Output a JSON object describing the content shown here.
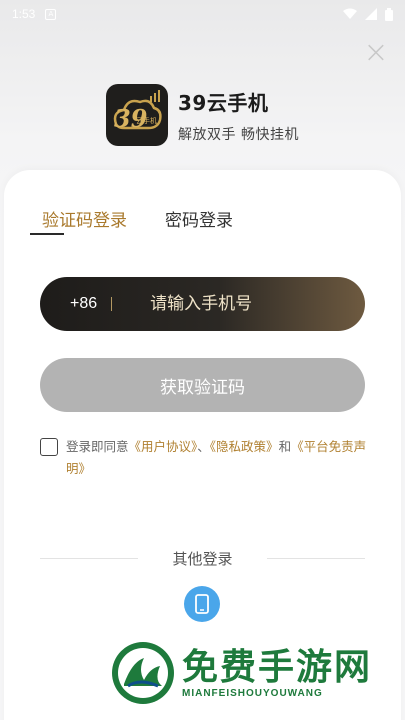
{
  "status_bar": {
    "time": "1:53",
    "notification_icon": "a-icon",
    "icons": [
      "wifi-icon",
      "signal-icon",
      "battery-icon"
    ]
  },
  "close_icon": "close-icon",
  "brand": {
    "logo_text": "39",
    "logo_subtext": "云手机",
    "name": "39云手机",
    "slogan": "解放双手 畅快挂机"
  },
  "tabs": [
    {
      "label": "验证码登录",
      "active": true
    },
    {
      "label": "密码登录",
      "active": false
    }
  ],
  "phone": {
    "country_code": "+86",
    "placeholder": "请输入手机号",
    "value": ""
  },
  "get_code_button": "获取验证码",
  "agreement": {
    "checked": false,
    "prefix": "登录即同意",
    "link1": "《用户协议》",
    "sep1": "、",
    "link2": "《隐私政策》",
    "sep2": "和",
    "link3": "《平台免责声明》"
  },
  "other_login": {
    "label": "其他登录",
    "methods": [
      "phone-icon"
    ]
  },
  "watermark": {
    "title": "免费手游网",
    "subtitle": "MIANFEISHOUYOUWANG"
  },
  "colors": {
    "accent": "#a9792c",
    "button_disabled": "#b3b3b3",
    "phone_login": "#4aa6ea",
    "watermark": "#1e7a3c"
  }
}
